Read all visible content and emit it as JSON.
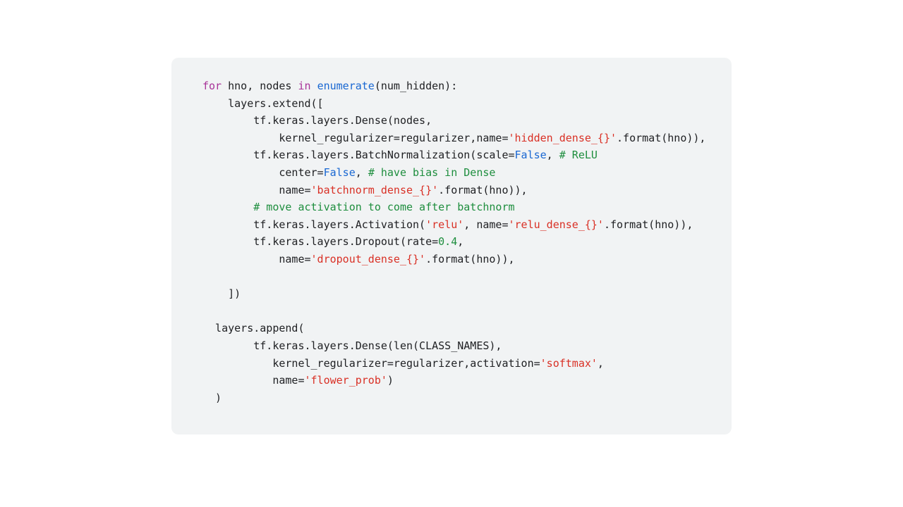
{
  "code": {
    "line1": {
      "a": "for",
      "b": " hno, nodes ",
      "c": "in",
      "d": " ",
      "e": "enumerate",
      "f": "(num_hidden):"
    },
    "line2": "    layers.extend([",
    "line3": "        tf.keras.layers.Dense(nodes,",
    "line4": {
      "a": "            kernel_regularizer=regularizer,name=",
      "b": "'hidden_dense_{}'",
      "c": ".format(hno)),"
    },
    "line5": {
      "a": "        tf.keras.layers.BatchNormalization(scale=",
      "b": "False",
      "c": ", ",
      "d": "# ReLU"
    },
    "line6": {
      "a": "            center=",
      "b": "False",
      "c": ", ",
      "d": "# have bias in Dense"
    },
    "line7": {
      "a": "            name=",
      "b": "'batchnorm_dense_{}'",
      "c": ".format(hno)),"
    },
    "line8": {
      "a": "        ",
      "b": "# move activation to come after batchnorm"
    },
    "line9": {
      "a": "        tf.keras.layers.Activation(",
      "b": "'relu'",
      "c": ", name=",
      "d": "'relu_dense_{}'",
      "e": ".format(hno)),"
    },
    "line10": {
      "a": "        tf.keras.layers.Dropout(rate=",
      "b": "0.4",
      "c": ","
    },
    "line11": {
      "a": "            name=",
      "b": "'dropout_dense_{}'",
      "c": ".format(hno)),"
    },
    "line12": "",
    "line13": "    ])",
    "line14": "",
    "line15": "  layers.append(",
    "line16": "        tf.keras.layers.Dense(len(CLASS_NAMES),",
    "line17": {
      "a": "           kernel_regularizer=regularizer,activation=",
      "b": "'softmax'",
      "c": ","
    },
    "line18": {
      "a": "           name=",
      "b": "'flower_prob'",
      "c": ")"
    },
    "line19": "  )"
  }
}
